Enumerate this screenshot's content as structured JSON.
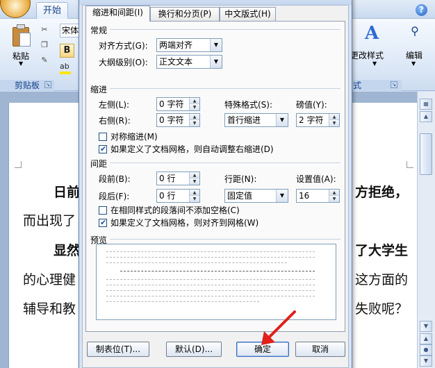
{
  "ribbon": {
    "tab_start": "开始",
    "help": "?",
    "paste_label": "粘贴",
    "font_name": "宋体",
    "bold": "B",
    "highlight": "ab",
    "clipboard_label": "剪贴板",
    "change_styles": "更改样式",
    "styles_partial": "式",
    "edit_label": "编辑"
  },
  "document": {
    "lines": [
      {
        "left": "日前",
        "right": "方拒绝，",
        "bold": true
      },
      {
        "left": "而出现了",
        "right": "",
        "bold": false
      },
      {
        "left": "显然",
        "right": "了大学生",
        "bold": true
      },
      {
        "left": "的心理健",
        "right": "这方面的",
        "bold": false
      },
      {
        "left": "辅导和教",
        "right": "失败呢？",
        "bold": false
      }
    ]
  },
  "dialog": {
    "tabs": [
      "缩进和间距(I)",
      "换行和分页(P)",
      "中文版式(H)"
    ],
    "general": {
      "heading": "常规",
      "alignment_label": "对齐方式(G):",
      "alignment_value": "两端对齐",
      "outline_label": "大纲级别(O):",
      "outline_value": "正文文本"
    },
    "indent": {
      "heading": "缩进",
      "left_label": "左侧(L):",
      "left_value": "0 字符",
      "right_label": "右侧(R):",
      "right_value": "0 字符",
      "special_label": "特殊格式(S):",
      "special_value": "首行缩进",
      "by_label": "磅值(Y):",
      "by_value": "2 字符",
      "mirror_label": "对称缩进(M)",
      "mirror_checked": false,
      "auto_right_label": "如果定义了文档网格，则自动调整右缩进(D)",
      "auto_right_checked": true
    },
    "spacing": {
      "heading": "间距",
      "before_label": "段前(B):",
      "before_value": "0 行",
      "after_label": "段后(F):",
      "after_value": "0 行",
      "line_label": "行距(N):",
      "line_value": "固定值",
      "at_label": "设置值(A):",
      "at_value": "16",
      "no_space_label": "在相同样式的段落间不添加空格(C)",
      "no_space_checked": false,
      "snap_grid_label": "如果定义了文档网格，则对齐到网格(W)",
      "snap_grid_checked": true
    },
    "preview": {
      "heading": "预览"
    },
    "buttons": {
      "tabs": "制表位(T)...",
      "default": "默认(D)...",
      "ok": "确定",
      "cancel": "取消"
    }
  },
  "colors": {
    "accent": "#15428b",
    "annotation_arrow": "#e0201a",
    "dialog_bg": "#f1f1f1"
  }
}
